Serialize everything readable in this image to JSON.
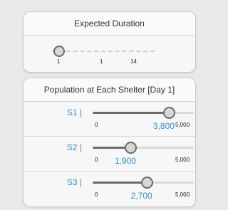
{
  "duration": {
    "title": "Expected Duration",
    "min_label": "1",
    "value_label": "1",
    "max_label": "14",
    "value": 1,
    "min": 1,
    "max": 14
  },
  "population": {
    "title": "Population at Each Shelter [Day 1]",
    "min_label": "0",
    "max_label": "5,000",
    "max": 5000,
    "shelters": [
      {
        "label": "S1 |",
        "value": 3800,
        "value_text": "3,800"
      },
      {
        "label": "S2 |",
        "value": 1900,
        "value_text": "1,900"
      },
      {
        "label": "S3 |",
        "value": 2700,
        "value_text": "2,700"
      }
    ]
  },
  "colors": {
    "accent": "#2f8fd0",
    "track_fill": "#6a6a6a",
    "track_bg": "#d9d9d9"
  }
}
